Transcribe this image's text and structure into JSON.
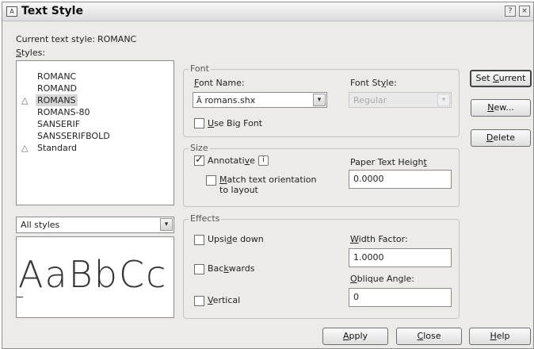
{
  "window": {
    "title": "Text Style",
    "help_glyph": "?",
    "close_glyph": "×",
    "icon": "autocad-text-icon"
  },
  "current_style": {
    "label": "Current text style:",
    "value": "ROMANC"
  },
  "styles": {
    "label": "Styles:",
    "items": [
      {
        "name": "ROMANC",
        "annotative": false,
        "selected": false
      },
      {
        "name": "ROMAND",
        "annotative": false,
        "selected": false
      },
      {
        "name": "ROMANS",
        "annotative": true,
        "selected": true
      },
      {
        "name": "ROMANS-80",
        "annotative": false,
        "selected": false
      },
      {
        "name": "SANSERIF",
        "annotative": false,
        "selected": false
      },
      {
        "name": "SANSSERIFBOLD",
        "annotative": false,
        "selected": false
      },
      {
        "name": "Standard",
        "annotative": true,
        "selected": false
      }
    ],
    "annotative_glyph": "△"
  },
  "filter": {
    "value": "All styles",
    "arrow": "▾"
  },
  "preview": {
    "text": "AaBbCc"
  },
  "font": {
    "legend": "Font",
    "font_name_label": "Font Name:",
    "font_name_value": "romans.shx",
    "font_icon_glyph": "Ã",
    "font_style_label": "Font Style:",
    "font_style_value": "Regular",
    "use_big_font_label": "Use Big Font",
    "use_big_font_checked": false,
    "arrow": "▾"
  },
  "size": {
    "legend": "Size",
    "annotative_label": "Annotative",
    "annotative_checked": true,
    "info_glyph": "i",
    "match_label_line1": "Match text orientation",
    "match_label_line2": "to layout",
    "match_checked": false,
    "paper_height_label": "Paper Text Height",
    "paper_height_value": "0.0000"
  },
  "effects": {
    "legend": "Effects",
    "upside_down_label": "Upside down",
    "backwards_label": "Backwards",
    "vertical_label": "Vertical",
    "width_factor_label": "Width Factor:",
    "width_factor_value": "1.0000",
    "oblique_label": "Oblique Angle:",
    "oblique_value": "0"
  },
  "buttons": {
    "set_current": "Set Current",
    "new": "New...",
    "delete": "Delete",
    "apply": "Apply",
    "close": "Close",
    "help": "Help"
  }
}
